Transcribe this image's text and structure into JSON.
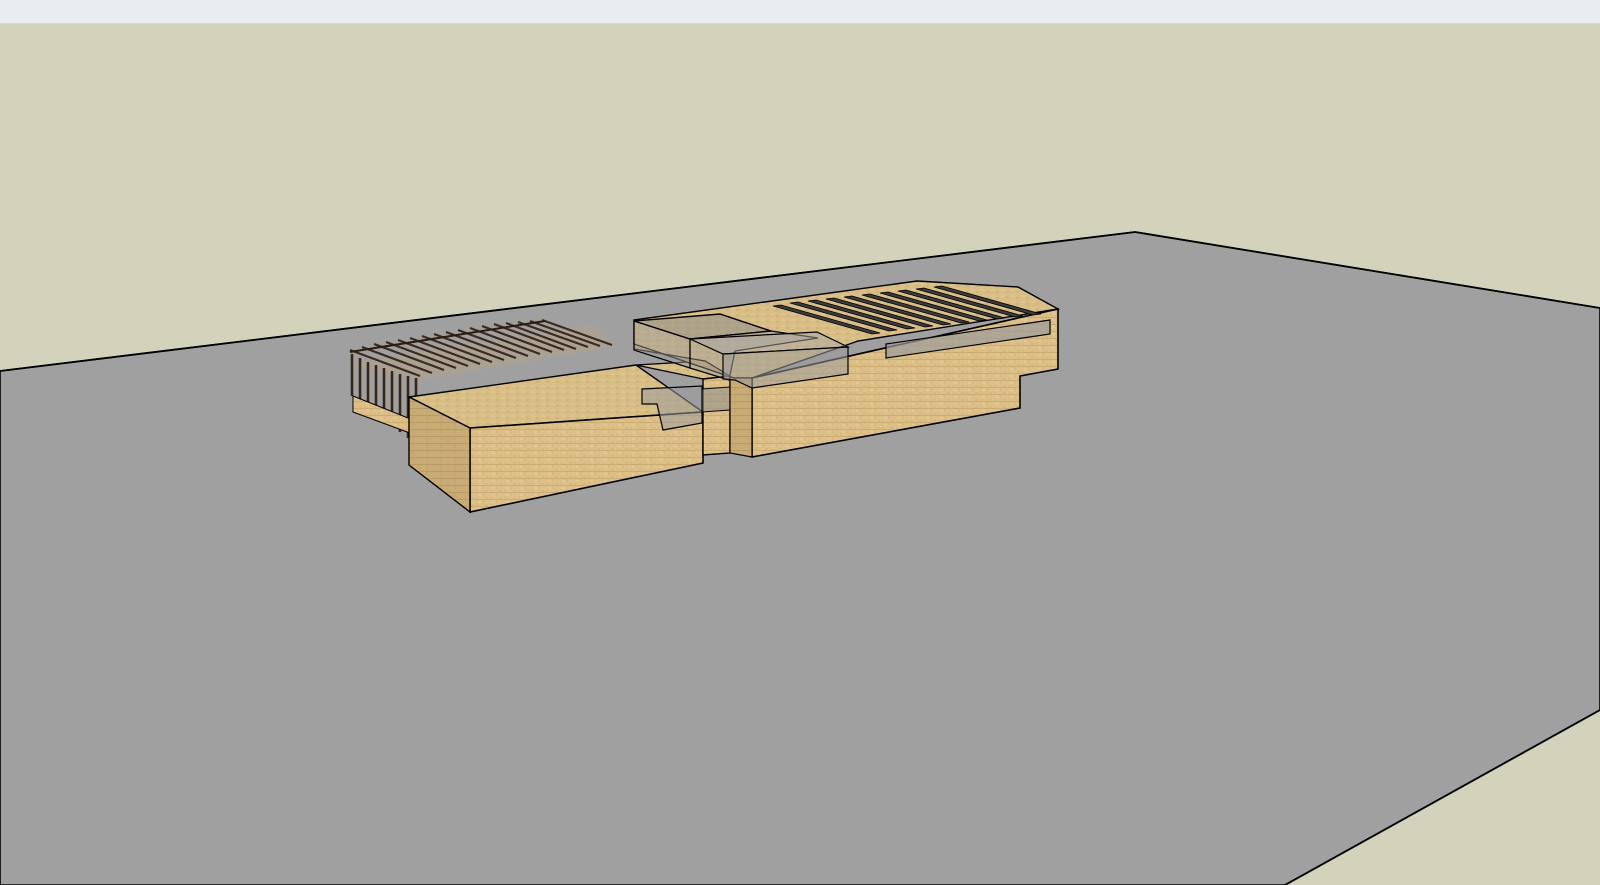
{
  "app": {
    "window_strip_color": "#e9edf1"
  },
  "viewport": {
    "sky_color": "#d3d2bb",
    "ground_color": "#a0a0a0",
    "edge_color": "#000000",
    "wall_material_color": "#dcc087",
    "glass_color": "#9b9b9b",
    "pergola_beam_color": "#3d2a1e"
  },
  "model": {
    "components": [
      "ground-plane",
      "left-building-volume",
      "pergola",
      "link-block",
      "glass-box-upper",
      "glass-box-link",
      "right-building-volume",
      "roof-slots",
      "clerestory-window"
    ]
  }
}
